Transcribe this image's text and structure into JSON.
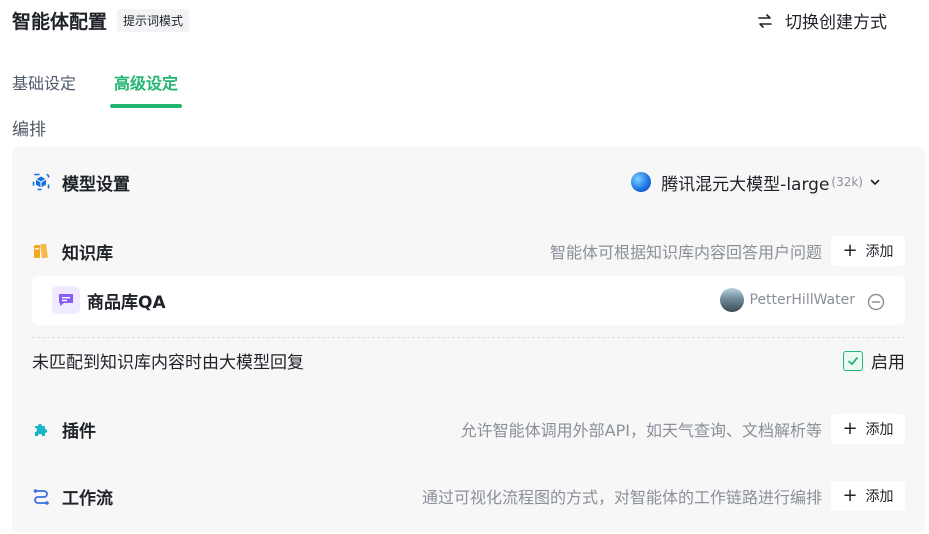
{
  "header": {
    "title": "智能体配置",
    "mode_badge": "提示词模式",
    "switch_label": "切换创建方式"
  },
  "tabs": [
    {
      "label": "基础设定",
      "active": false
    },
    {
      "label": "高级设定",
      "active": true
    }
  ],
  "section_label": "编排",
  "model": {
    "label": "模型设置",
    "selected_name": "腾讯混元大模型-large",
    "context": "(32k)"
  },
  "knowledge": {
    "label": "知识库",
    "description": "智能体可根据知识库内容回答用户问题",
    "add_label": "添加",
    "items": [
      {
        "name": "商品库QA",
        "owner": "PetterHillWater"
      }
    ],
    "fallback_text": "未匹配到知识库内容时由大模型回复",
    "enable_label": "启用",
    "enabled": true
  },
  "plugins": {
    "label": "插件",
    "description": "允许智能体调用外部API，如天气查询、文档解析等",
    "add_label": "添加"
  },
  "workflow": {
    "label": "工作流",
    "description": "通过可视化流程图的方式，对智能体的工作链路进行编排",
    "add_label": "添加"
  },
  "colors": {
    "accent": "#22b573",
    "model_icon": "#1a6fe0",
    "knowledge_icon": "#f5a623",
    "plugin_icon": "#18b6c9",
    "workflow_icon": "#3b6fe0",
    "kb_item_icon": "#8b5cf6"
  },
  "icons": {
    "switch": "swap-arrows-icon",
    "model": "model-cube-icon",
    "knowledge": "books-icon",
    "kb_item": "chat-bubble-icon",
    "plugin": "puzzle-icon",
    "workflow": "flow-icon",
    "remove": "minus-circle-icon",
    "dropdown": "chevron-down-icon",
    "check": "check-icon"
  }
}
